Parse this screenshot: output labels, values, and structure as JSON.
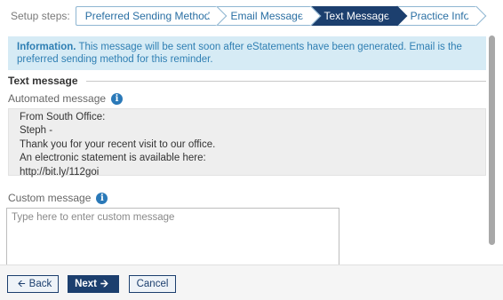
{
  "steps": {
    "label": "Setup steps:",
    "items": [
      {
        "label": "Preferred Sending Method",
        "active": false
      },
      {
        "label": "Email Message",
        "active": false
      },
      {
        "label": "Text Message",
        "active": true
      },
      {
        "label": "Practice Info",
        "active": false
      }
    ]
  },
  "info": {
    "title": "Information.",
    "text": " This message will be sent soon after eStatements have been generated. Email is the preferred sending method for this reminder."
  },
  "section": {
    "title": "Text message"
  },
  "automated": {
    "label": "Automated message",
    "icon": "info-icon",
    "lines": [
      "From South Office:",
      "Steph -",
      "Thank you for your recent visit to our office.",
      "An electronic statement is available here:",
      "http://bit.ly/112goi"
    ]
  },
  "custom": {
    "label": "Custom message",
    "icon": "info-icon",
    "placeholder": "Type here to enter custom message",
    "value": ""
  },
  "footer": {
    "back_label": "Back",
    "next_label": "Next",
    "cancel_label": "Cancel",
    "back_icon": "arrow-left-icon",
    "next_icon": "arrow-right-icon"
  },
  "colors": {
    "primary": "#1c3f6e",
    "info_bg": "#d6ebf5",
    "info_text": "#2f7fb3",
    "step_text": "#2a6fa3"
  }
}
